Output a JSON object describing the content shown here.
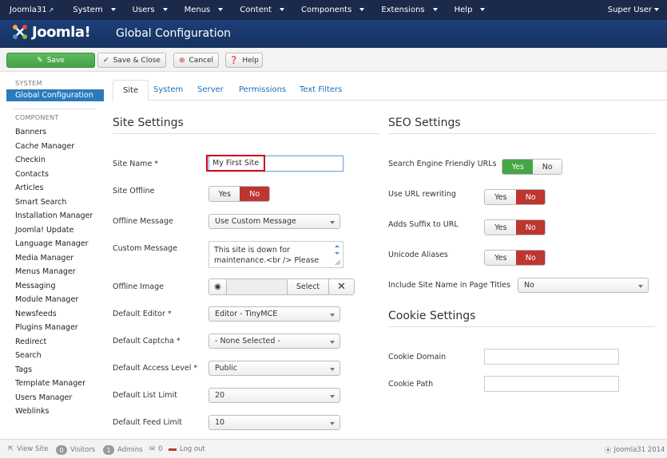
{
  "topnav": {
    "brand": "Joomla31",
    "brand_icon": "external-link-icon",
    "menus": [
      "System",
      "Users",
      "Menus",
      "Content",
      "Components",
      "Extensions",
      "Help"
    ],
    "user": "Super User"
  },
  "header": {
    "logo_text": "Joomla!",
    "title": "Global Configuration"
  },
  "toolbar": {
    "save": "Save",
    "save_close": "Save & Close",
    "cancel": "Cancel",
    "help": "Help"
  },
  "sidebar": {
    "system_heading": "SYSTEM",
    "active_item": "Global Configuration",
    "component_heading": "COMPONENT",
    "items": [
      "Banners",
      "Cache Manager",
      "Checkin",
      "Contacts",
      "Articles",
      "Smart Search",
      "Installation Manager",
      "Joomla! Update",
      "Language Manager",
      "Media Manager",
      "Menus Manager",
      "Messaging",
      "Module Manager",
      "Newsfeeds",
      "Plugins Manager",
      "Redirect",
      "Search",
      "Tags",
      "Template Manager",
      "Users Manager",
      "Weblinks"
    ]
  },
  "tabs": [
    "Site",
    "System",
    "Server",
    "Permissions",
    "Text Filters"
  ],
  "site": {
    "title": "Site Settings",
    "site_name_label": "Site Name *",
    "site_name_value": "My First Site",
    "site_offline_label": "Site Offline",
    "offline_message_label": "Offline Message",
    "offline_message_value": "Use Custom Message",
    "custom_message_label": "Custom Message",
    "custom_message_line1": "This site is down for",
    "custom_message_line2": "maintenance.<br /> Please",
    "offline_image_label": "Offline Image",
    "select_label": "Select",
    "default_editor_label": "Default Editor *",
    "default_editor_value": "Editor - TinyMCE",
    "default_captcha_label": "Default Captcha *",
    "default_captcha_value": "- None Selected -",
    "default_access_label": "Default Access Level *",
    "default_access_value": "Public",
    "list_limit_label": "Default List Limit",
    "list_limit_value": "20",
    "feed_limit_label": "Default Feed Limit",
    "feed_limit_value": "10"
  },
  "toggle": {
    "yes": "Yes",
    "no": "No"
  },
  "seo": {
    "title": "SEO Settings",
    "sef_label": "Search Engine Friendly URLs",
    "rewrite_label": "Use URL rewriting",
    "suffix_label": "Adds Suffix to URL",
    "unicode_label": "Unicode Aliases",
    "sitename_label": "Include Site Name in Page Titles",
    "sitename_value": "No"
  },
  "cookie": {
    "title": "Cookie Settings",
    "domain_label": "Cookie Domain",
    "path_label": "Cookie Path"
  },
  "footer": {
    "view_site": "View Site",
    "visitors_count": "0",
    "visitors_label": "Visitors",
    "admins_count": "1",
    "admins_label": "Admins",
    "messages_count": "0",
    "logout": "Log out",
    "copyright": "Joomla31 2014"
  },
  "colors": {
    "navbar": "#1b2a4a",
    "header": "#1c3f78",
    "save_green": "#46a246",
    "active_blue": "#2a7bbd",
    "toggle_red": "#bd362f",
    "toggle_green": "#46a546",
    "highlight": "#d0021b"
  }
}
